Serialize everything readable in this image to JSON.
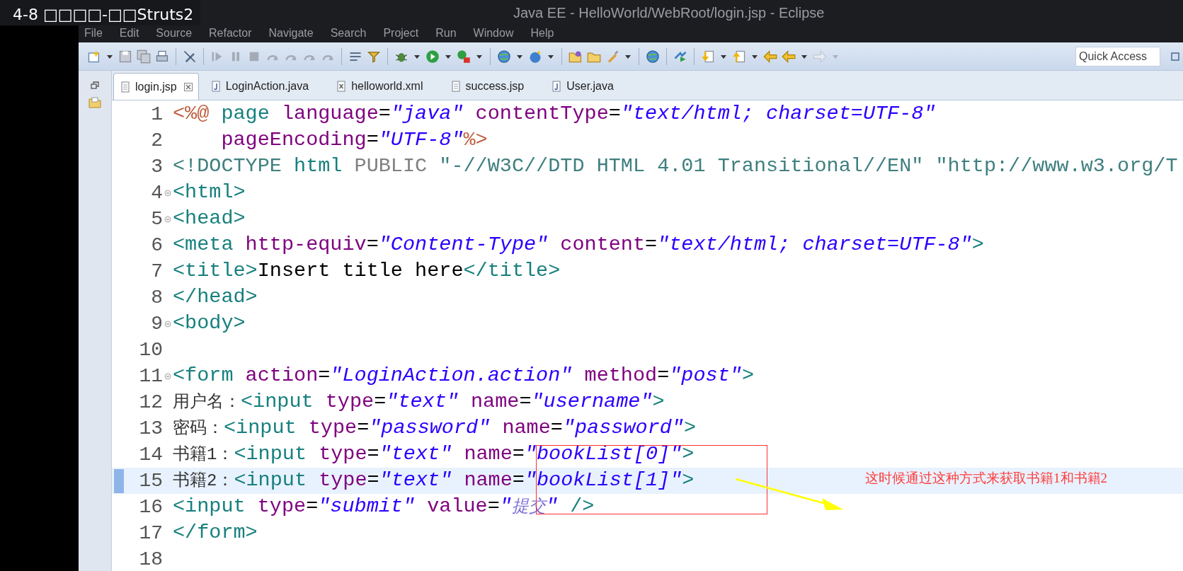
{
  "video_title": "4-8 □□□□-□□Struts2",
  "window": {
    "title": "Java EE - HelloWorld/WebRoot/login.jsp - Eclipse"
  },
  "menu": [
    "File",
    "Edit",
    "Source",
    "Refactor",
    "Navigate",
    "Search",
    "Project",
    "Run",
    "Window",
    "Help"
  ],
  "quick_access": {
    "placeholder": "Quick Access"
  },
  "tabs": [
    {
      "label": "login.jsp",
      "kind": "jsp",
      "selected": true
    },
    {
      "label": "LoginAction.java",
      "kind": "java",
      "selected": false
    },
    {
      "label": "helloworld.xml",
      "kind": "xml",
      "selected": false
    },
    {
      "label": "success.jsp",
      "kind": "jsp",
      "selected": false
    },
    {
      "label": "User.java",
      "kind": "java",
      "selected": false
    }
  ],
  "editor": {
    "lines": [
      {
        "number": "1",
        "foldable": false,
        "current": false,
        "tokens": [
          {
            "kind": "dir",
            "text": "<%@"
          },
          {
            "kind": "tag",
            "text": " page"
          },
          {
            "kind": "attr",
            "text": " language"
          },
          {
            "kind": "text",
            "text": "="
          },
          {
            "kind": "str",
            "text": "\"java\""
          },
          {
            "kind": "attr",
            "text": " contentType"
          },
          {
            "kind": "text",
            "text": "="
          },
          {
            "kind": "str",
            "text": "\"text/html; charset=UTF-8\""
          }
        ]
      },
      {
        "number": "2",
        "foldable": false,
        "current": false,
        "tokens": [
          {
            "kind": "attr",
            "text": "    pageEncoding"
          },
          {
            "kind": "text",
            "text": "="
          },
          {
            "kind": "str",
            "text": "\"UTF-8\""
          },
          {
            "kind": "dir",
            "text": "%>"
          }
        ]
      },
      {
        "number": "3",
        "foldable": false,
        "current": false,
        "tokens": [
          {
            "kind": "doc",
            "text": "<!DOCTYPE"
          },
          {
            "kind": "tag",
            "text": " html"
          },
          {
            "kind": "kw",
            "text": " PUBLIC"
          },
          {
            "kind": "doc",
            "text": " \"-//W3C//DTD HTML 4.01 Transitional//EN\" \"http://www.w3.org/T"
          }
        ]
      },
      {
        "number": "4",
        "foldable": true,
        "current": false,
        "tokens": [
          {
            "kind": "tag",
            "text": "<html>"
          }
        ]
      },
      {
        "number": "5",
        "foldable": true,
        "current": false,
        "tokens": [
          {
            "kind": "tag",
            "text": "<head>"
          }
        ]
      },
      {
        "number": "6",
        "foldable": false,
        "current": false,
        "tokens": [
          {
            "kind": "tag",
            "text": "<meta"
          },
          {
            "kind": "attr",
            "text": " http-equiv"
          },
          {
            "kind": "text",
            "text": "="
          },
          {
            "kind": "str",
            "text": "\"Content-Type\""
          },
          {
            "kind": "attr",
            "text": " content"
          },
          {
            "kind": "text",
            "text": "="
          },
          {
            "kind": "str",
            "text": "\"text/html; charset=UTF-8\""
          },
          {
            "kind": "tag",
            "text": ">"
          }
        ]
      },
      {
        "number": "7",
        "foldable": false,
        "current": false,
        "tokens": [
          {
            "kind": "tag",
            "text": "<title>"
          },
          {
            "kind": "text",
            "text": "Insert title here"
          },
          {
            "kind": "tag",
            "text": "</title>"
          }
        ]
      },
      {
        "number": "8",
        "foldable": false,
        "current": false,
        "tokens": [
          {
            "kind": "tag",
            "text": "</head>"
          }
        ]
      },
      {
        "number": "9",
        "foldable": true,
        "current": false,
        "tokens": [
          {
            "kind": "tag",
            "text": "<body>"
          }
        ]
      },
      {
        "number": "10",
        "foldable": false,
        "current": false
      },
      {
        "number": "11",
        "foldable": true,
        "current": false,
        "tokens": [
          {
            "kind": "tag",
            "text": "<form"
          },
          {
            "kind": "attr",
            "text": " action"
          },
          {
            "kind": "text",
            "text": "="
          },
          {
            "kind": "str",
            "text": "\"LoginAction.action\""
          },
          {
            "kind": "attr",
            "text": " method"
          },
          {
            "kind": "text",
            "text": "="
          },
          {
            "kind": "str",
            "text": "\"post\""
          },
          {
            "kind": "tag",
            "text": ">"
          }
        ]
      },
      {
        "number": "12",
        "foldable": false,
        "current": false,
        "tokens": [
          {
            "kind": "cjk",
            "text": "用户名："
          },
          {
            "kind": "tag",
            "text": "<input"
          },
          {
            "kind": "attr",
            "text": " type"
          },
          {
            "kind": "text",
            "text": "="
          },
          {
            "kind": "str",
            "text": "\"text\""
          },
          {
            "kind": "attr",
            "text": " name"
          },
          {
            "kind": "text",
            "text": "="
          },
          {
            "kind": "str",
            "text": "\"username\""
          },
          {
            "kind": "tag",
            "text": ">"
          }
        ]
      },
      {
        "number": "13",
        "foldable": false,
        "current": false,
        "tokens": [
          {
            "kind": "cjk",
            "text": "密码："
          },
          {
            "kind": "tag",
            "text": "<input"
          },
          {
            "kind": "attr",
            "text": " type"
          },
          {
            "kind": "text",
            "text": "="
          },
          {
            "kind": "str",
            "text": "\"password\""
          },
          {
            "kind": "attr",
            "text": " name"
          },
          {
            "kind": "text",
            "text": "="
          },
          {
            "kind": "str",
            "text": "\"password\""
          },
          {
            "kind": "tag",
            "text": ">"
          }
        ]
      },
      {
        "number": "14",
        "foldable": false,
        "current": false,
        "tokens": [
          {
            "kind": "cjk",
            "text": "书籍1："
          },
          {
            "kind": "tag",
            "text": "<input"
          },
          {
            "kind": "attr",
            "text": " type"
          },
          {
            "kind": "text",
            "text": "="
          },
          {
            "kind": "str",
            "text": "\"text\""
          },
          {
            "kind": "attr",
            "text": " name"
          },
          {
            "kind": "text",
            "text": "="
          },
          {
            "kind": "str",
            "text": "\"bookList[0]\""
          },
          {
            "kind": "tag",
            "text": ">"
          }
        ]
      },
      {
        "number": "15",
        "foldable": false,
        "current": true,
        "tokens": [
          {
            "kind": "cjk",
            "text": "书籍2："
          },
          {
            "kind": "tag",
            "text": "<input"
          },
          {
            "kind": "attr",
            "text": " type"
          },
          {
            "kind": "text",
            "text": "="
          },
          {
            "kind": "str",
            "text": "\"text\""
          },
          {
            "kind": "attr",
            "text": " name"
          },
          {
            "kind": "text",
            "text": "="
          },
          {
            "kind": "str",
            "text": "\"bookList[1]\""
          },
          {
            "kind": "tag",
            "text": ">"
          }
        ]
      },
      {
        "number": "16",
        "foldable": false,
        "current": false,
        "tokens": [
          {
            "kind": "tag",
            "text": "<input"
          },
          {
            "kind": "attr",
            "text": " type"
          },
          {
            "kind": "text",
            "text": "="
          },
          {
            "kind": "str",
            "text": "\"submit\""
          },
          {
            "kind": "attr",
            "text": " value"
          },
          {
            "kind": "text",
            "text": "="
          },
          {
            "kind": "str",
            "text": "\""
          },
          {
            "kind": "str_light",
            "text": "提交"
          },
          {
            "kind": "str",
            "text": "\""
          },
          {
            "kind": "tag",
            "text": " />"
          }
        ]
      },
      {
        "number": "17",
        "foldable": false,
        "current": false,
        "tokens": [
          {
            "kind": "tag",
            "text": "</form>"
          }
        ]
      },
      {
        "number": "18",
        "foldable": false,
        "current": false
      }
    ]
  },
  "annotation": {
    "text": "这时候通过这种方式来获取书籍1和书籍2"
  }
}
